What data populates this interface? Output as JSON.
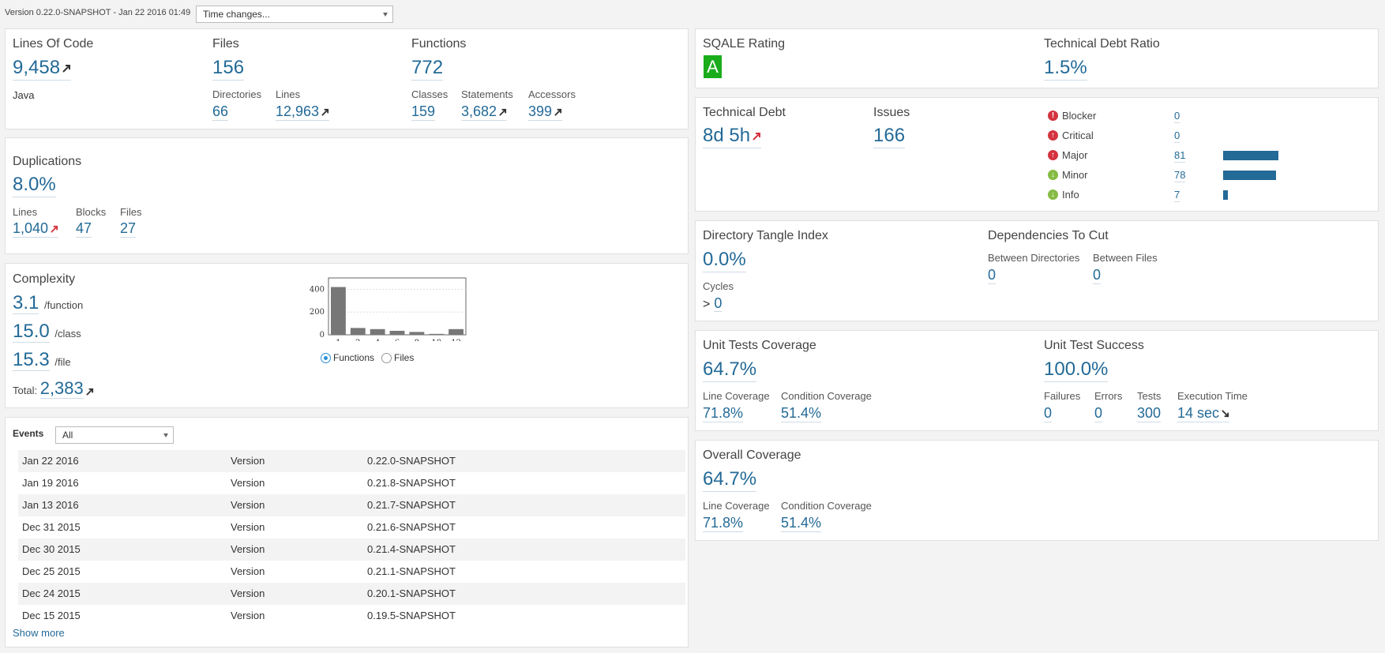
{
  "header": {
    "version_text": "Version 0.22.0-SNAPSHOT - Jan 22 2016 01:49",
    "time_changes": "Time changes..."
  },
  "size": {
    "loc_title": "Lines Of Code",
    "loc_value": "9,458",
    "language": "Java",
    "files_title": "Files",
    "files_value": "156",
    "directories_label": "Directories",
    "directories_value": "66",
    "lines_label": "Lines",
    "lines_value": "12,963",
    "functions_title": "Functions",
    "functions_value": "772",
    "classes_label": "Classes",
    "classes_value": "159",
    "statements_label": "Statements",
    "statements_value": "3,682",
    "accessors_label": "Accessors",
    "accessors_value": "399"
  },
  "duplications": {
    "title": "Duplications",
    "value": "8.0%",
    "lines_label": "Lines",
    "lines_value": "1,040",
    "blocks_label": "Blocks",
    "blocks_value": "47",
    "files_label": "Files",
    "files_value": "27"
  },
  "complexity": {
    "title": "Complexity",
    "per_function": "3.1",
    "per_function_unit": "/function",
    "per_class": "15.0",
    "per_class_unit": "/class",
    "per_file": "15.3",
    "per_file_unit": "/file",
    "total_label": "Total:",
    "total_value": "2,383",
    "radio_functions": "Functions",
    "radio_files": "Files",
    "selected": "Functions"
  },
  "chart_data": {
    "type": "bar",
    "categories": [
      "1",
      "2",
      "4",
      "6",
      "8",
      "10",
      "12"
    ],
    "values": [
      420,
      60,
      50,
      35,
      25,
      8,
      50
    ],
    "yticks": [
      "400",
      "200",
      "0"
    ],
    "ylim": [
      0,
      500
    ],
    "xlabel": "",
    "ylabel": "",
    "title": ""
  },
  "events": {
    "title": "Events",
    "filter": "All",
    "rows": [
      {
        "date": "Jan 22 2016",
        "type": "Version",
        "name": "0.22.0-SNAPSHOT"
      },
      {
        "date": "Jan 19 2016",
        "type": "Version",
        "name": "0.21.8-SNAPSHOT"
      },
      {
        "date": "Jan 13 2016",
        "type": "Version",
        "name": "0.21.7-SNAPSHOT"
      },
      {
        "date": "Dec 31 2015",
        "type": "Version",
        "name": "0.21.6-SNAPSHOT"
      },
      {
        "date": "Dec 30 2015",
        "type": "Version",
        "name": "0.21.4-SNAPSHOT"
      },
      {
        "date": "Dec 25 2015",
        "type": "Version",
        "name": "0.21.1-SNAPSHOT"
      },
      {
        "date": "Dec 24 2015",
        "type": "Version",
        "name": "0.20.1-SNAPSHOT"
      },
      {
        "date": "Dec 15 2015",
        "type": "Version",
        "name": "0.19.5-SNAPSHOT"
      }
    ],
    "show_more": "Show more"
  },
  "sqale": {
    "rating_title": "SQALE Rating",
    "rating_value": "A",
    "rating_color": "#1aac1a",
    "ratio_title": "Technical Debt Ratio",
    "ratio_value": "1.5%"
  },
  "debt": {
    "debt_title": "Technical Debt",
    "debt_value": "8d 5h",
    "issues_title": "Issues",
    "issues_value": "166",
    "severities": [
      {
        "label": "Blocker",
        "count": "0",
        "value": 0,
        "icon": "blocker-icon",
        "color": "#d4333f"
      },
      {
        "label": "Critical",
        "count": "0",
        "value": 0,
        "icon": "critical-icon",
        "color": "#d4333f"
      },
      {
        "label": "Major",
        "count": "81",
        "value": 81,
        "icon": "major-icon",
        "color": "#d4333f"
      },
      {
        "label": "Minor",
        "count": "78",
        "value": 78,
        "icon": "minor-icon",
        "color": "#85bb43"
      },
      {
        "label": "Info",
        "count": "7",
        "value": 7,
        "icon": "info-icon",
        "color": "#85bb43"
      }
    ]
  },
  "design": {
    "tangle_title": "Directory Tangle Index",
    "tangle_value": "0.0%",
    "cycles_label": "Cycles",
    "cycles_prefix": ">",
    "cycles_value": "0",
    "deps_title": "Dependencies To Cut",
    "between_dirs_label": "Between Directories",
    "between_dirs_value": "0",
    "between_files_label": "Between Files",
    "between_files_value": "0"
  },
  "tests": {
    "coverage_title": "Unit Tests Coverage",
    "coverage_value": "64.7%",
    "line_cov_label": "Line Coverage",
    "line_cov_value": "71.8%",
    "cond_cov_label": "Condition Coverage",
    "cond_cov_value": "51.4%",
    "success_title": "Unit Test Success",
    "success_value": "100.0%",
    "failures_label": "Failures",
    "failures_value": "0",
    "errors_label": "Errors",
    "errors_value": "0",
    "tests_label": "Tests",
    "tests_value": "300",
    "exec_label": "Execution Time",
    "exec_value": "14 sec"
  },
  "overall": {
    "title": "Overall Coverage",
    "value": "64.7%",
    "line_cov_label": "Line Coverage",
    "line_cov_value": "71.8%",
    "cond_cov_label": "Condition Coverage",
    "cond_cov_value": "51.4%"
  }
}
